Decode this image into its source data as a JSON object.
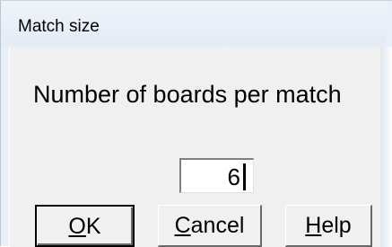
{
  "window": {
    "title": "Match size"
  },
  "dialog": {
    "prompt": "Number of boards per match",
    "input_value": "6"
  },
  "buttons": {
    "ok": {
      "mnemonic": "O",
      "rest": "K"
    },
    "cancel": {
      "mnemonic": "C",
      "rest": "ancel"
    },
    "help": {
      "mnemonic": "H",
      "rest": "elp"
    }
  }
}
